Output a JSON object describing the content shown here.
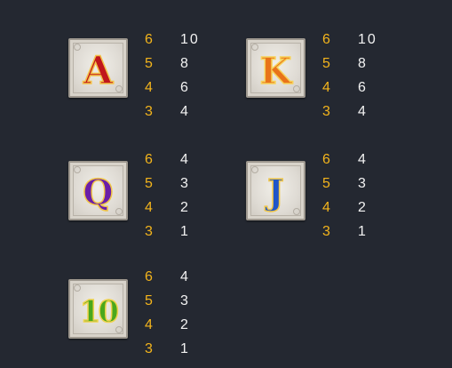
{
  "paytable": [
    {
      "symbol": "A",
      "icon": "letter-a-icon",
      "fill": "#c0161c",
      "stroke": "#f3c34a",
      "pays": [
        {
          "count": "6",
          "value": "10"
        },
        {
          "count": "5",
          "value": "8"
        },
        {
          "count": "4",
          "value": "6"
        },
        {
          "count": "3",
          "value": "4"
        }
      ]
    },
    {
      "symbol": "K",
      "icon": "letter-k-icon",
      "fill": "#e8731a",
      "stroke": "#f7d25a",
      "pays": [
        {
          "count": "6",
          "value": "10"
        },
        {
          "count": "5",
          "value": "8"
        },
        {
          "count": "4",
          "value": "6"
        },
        {
          "count": "3",
          "value": "4"
        }
      ]
    },
    {
      "symbol": "Q",
      "icon": "letter-q-icon",
      "fill": "#6b1fa8",
      "stroke": "#f0c648",
      "pays": [
        {
          "count": "6",
          "value": "4"
        },
        {
          "count": "5",
          "value": "3"
        },
        {
          "count": "4",
          "value": "2"
        },
        {
          "count": "3",
          "value": "1"
        }
      ]
    },
    {
      "symbol": "J",
      "icon": "letter-j-icon",
      "fill": "#1f55c9",
      "stroke": "#f0c648",
      "pays": [
        {
          "count": "6",
          "value": "4"
        },
        {
          "count": "5",
          "value": "3"
        },
        {
          "count": "4",
          "value": "2"
        },
        {
          "count": "3",
          "value": "1"
        }
      ]
    },
    {
      "symbol": "10",
      "icon": "number-ten-icon",
      "fill": "#4aa81c",
      "stroke": "#f0d24e",
      "pays": [
        {
          "count": "6",
          "value": "4"
        },
        {
          "count": "5",
          "value": "3"
        },
        {
          "count": "4",
          "value": "2"
        },
        {
          "count": "3",
          "value": "1"
        }
      ]
    }
  ]
}
